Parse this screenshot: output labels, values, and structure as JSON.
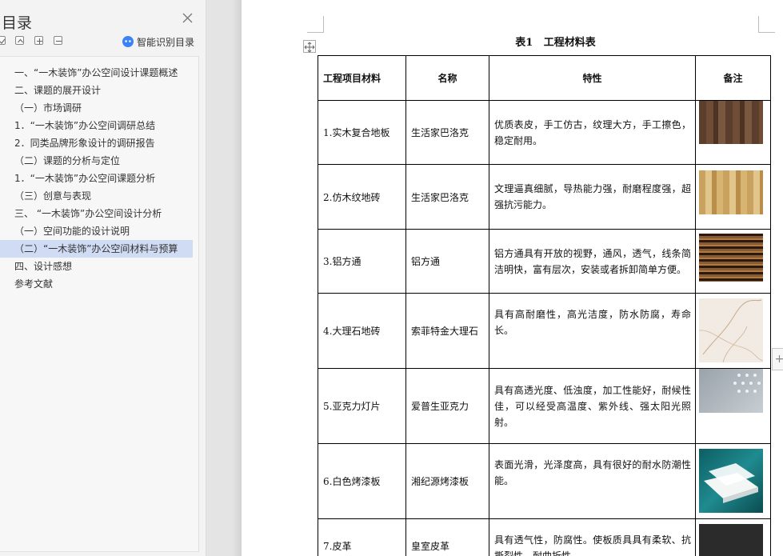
{
  "toc": {
    "title": "目录",
    "smart_label": "智能识别目录",
    "items": [
      {
        "label": "一、“一木装饰”办公空间设计课题概述",
        "active": false
      },
      {
        "label": "二、课题的展开设计",
        "active": false
      },
      {
        "label": "（一）市场调研",
        "active": false
      },
      {
        "label": "1．“一木装饰”办公空间调研总结",
        "active": false
      },
      {
        "label": "2．同类品牌形象设计的调研报告",
        "active": false
      },
      {
        "label": "（二）课题的分析与定位",
        "active": false
      },
      {
        "label": "1．“一木装饰”办公空间课题分析",
        "active": false
      },
      {
        "label": "（三）创意与表现",
        "active": false
      },
      {
        "label": "三、 “一木装饰”办公空间设计分析",
        "active": false
      },
      {
        "label": "（一）空间功能的设计说明",
        "active": false
      },
      {
        "label": "（二）“一木装饰”办公空间材料与预算",
        "active": true
      },
      {
        "label": "四、设计感想",
        "active": false
      },
      {
        "label": "参考文献",
        "active": false
      }
    ]
  },
  "document": {
    "caption": "表1   工程材料表",
    "headers": [
      "工程项目材料",
      "名称",
      "特性",
      "备注"
    ],
    "rows": [
      {
        "item": "1.实木复合地板",
        "name": "生活家巴洛克",
        "desc": "优质表皮，手工仿古，纹理大方，手工擦色，稳定耐用。"
      },
      {
        "item": "2.仿木纹地砖",
        "name": "生活家巴洛克",
        "desc": "文理逼真细腻，导热能力强，耐磨程度强，超强抗污能力。"
      },
      {
        "item": "3.铝方通",
        "name": "铝方通",
        "desc": "铝方通具有开放的视野，通风，透气，线条简洁明快，富有层次，安装或者拆卸简单方便。"
      },
      {
        "item": "4.大理石地砖",
        "name": "索菲特金大理石",
        "desc": "具有高耐磨性，高光洁度，防水防腐，寿命长。"
      },
      {
        "item": "5.亚克力灯片",
        "name": "爱普生亚克力",
        "desc": "具有高透光度、低浊度，加工性能好，耐候性佳，可以经受高温度、紫外线、强太阳光照射。"
      },
      {
        "item": "6.白色烤漆板",
        "name": "湘纪源烤漆板",
        "desc": "表面光滑，光泽度高，具有很好的耐水防潮性能。"
      },
      {
        "item": "7.皮革",
        "name": "皇室皮革",
        "desc": "具有透气性，防腐性。使板质具具有柔软、抗撕裂性，耐曲折性。"
      }
    ]
  }
}
